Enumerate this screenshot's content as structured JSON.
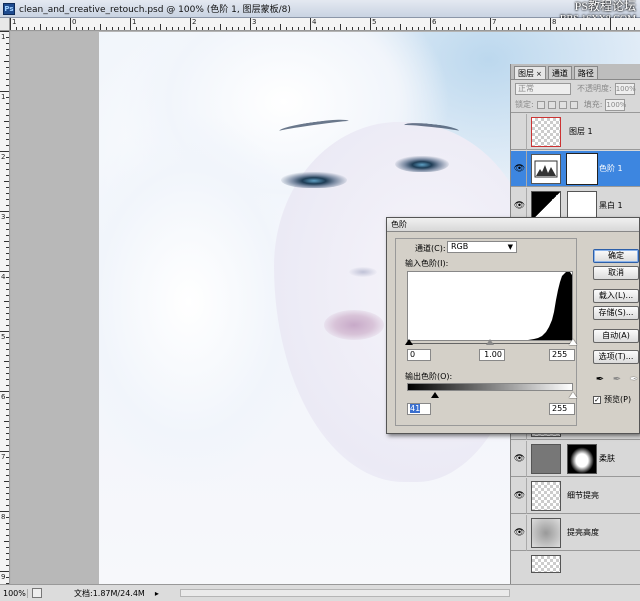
{
  "window": {
    "title": "clean_and_creative_retouch.psd @ 100% (色阶 1, 图层蒙板/8)"
  },
  "watermark": {
    "line1": "PS教程论坛",
    "line2": "BBS.16XX8.COM"
  },
  "rulers": {
    "h_labels": [
      "1",
      "0",
      "1",
      "2",
      "3",
      "4",
      "5",
      "6",
      "7",
      "8"
    ],
    "v_labels": [
      "1",
      "1",
      "2",
      "3",
      "4",
      "5",
      "6",
      "7",
      "8",
      "9"
    ]
  },
  "status": {
    "zoom": "100%",
    "doc": "文档:1.87M/24.4M"
  },
  "layers_panel": {
    "tabs": [
      {
        "label": "图层",
        "close": "×"
      },
      {
        "label": "通道"
      },
      {
        "label": "路径"
      }
    ],
    "blend_mode": "正常",
    "opacity_label": "不透明度:",
    "opacity_value": "100%",
    "lock_label": "锁定:",
    "fill_label": "填充:",
    "fill_value": "100%",
    "layers": [
      {
        "name": "图层 1"
      },
      {
        "name": "色阶 1"
      },
      {
        "name": "黑白 1"
      },
      {
        "name": ""
      },
      {
        "name": "柔肤"
      },
      {
        "name": "细节提亮"
      },
      {
        "name": "提亮高度"
      }
    ],
    "footer_icons": [
      "link-icon",
      "fx-icon",
      "mask-icon",
      "adjustment-icon",
      "group-icon",
      "new-layer-icon",
      "delete-icon"
    ]
  },
  "levels_dialog": {
    "title": "色阶",
    "channel_label": "通道(C):",
    "channel_value": "RGB",
    "input_label": "输入色阶(I):",
    "input_black": "0",
    "input_gamma": "1.00",
    "input_white": "255",
    "output_label": "输出色阶(O):",
    "output_black": "41",
    "output_white": "255",
    "buttons": {
      "ok": "确定",
      "cancel": "取消",
      "load": "载入(L)...",
      "save": "存储(S)...",
      "auto": "自动(A)",
      "options": "选项(T)..."
    },
    "preview_label": "预览(P)",
    "preview_checked": true
  }
}
